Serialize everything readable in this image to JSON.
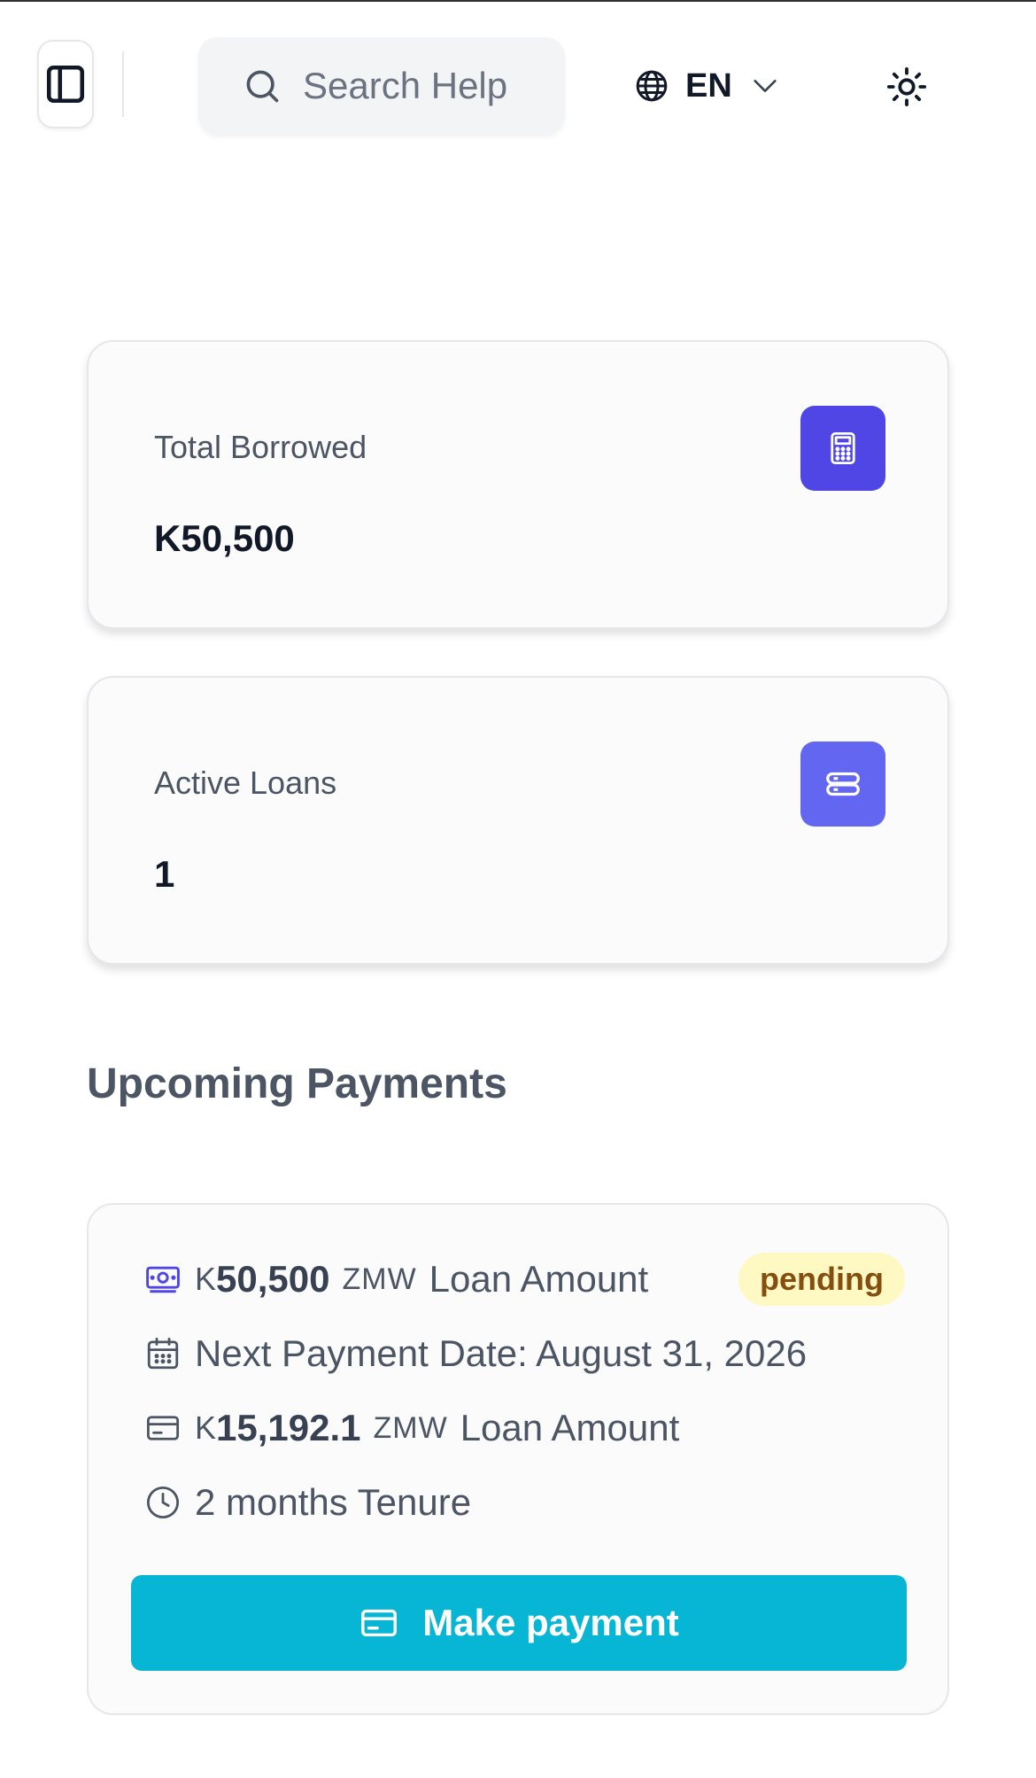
{
  "header": {
    "search_label": "Search Help",
    "language": "EN",
    "icons": {
      "sidebar_toggle": "sidebar-panel-icon",
      "search": "search-icon",
      "language": "globe-icon",
      "chevron": "chevron-down-icon",
      "theme": "sun-icon"
    }
  },
  "stats": [
    {
      "label": "Total Borrowed",
      "value": "K50,500",
      "icon": "calculator-icon",
      "icon_bg": "#4f46e5"
    },
    {
      "label": "Active Loans",
      "value": "1",
      "icon": "database-icon",
      "icon_bg": "#6366f1"
    }
  ],
  "upcoming": {
    "title": "Upcoming Payments",
    "payment": {
      "loan_amount": {
        "symbol": "K",
        "amount": "50,500",
        "currency": "ZMW",
        "label": "Loan Amount"
      },
      "status": "pending",
      "next_payment": "Next Payment Date: August 31, 2026",
      "installment": {
        "symbol": "K",
        "amount": "15,192.1",
        "currency": "ZMW",
        "label": "Loan Amount"
      },
      "tenure": "2 months Tenure",
      "button_label": "Make payment"
    }
  },
  "colors": {
    "accent_button": "#06b6d4",
    "badge_bg": "#fef9c3",
    "badge_text": "#854d0e",
    "money_icon": "#4f46e5"
  }
}
